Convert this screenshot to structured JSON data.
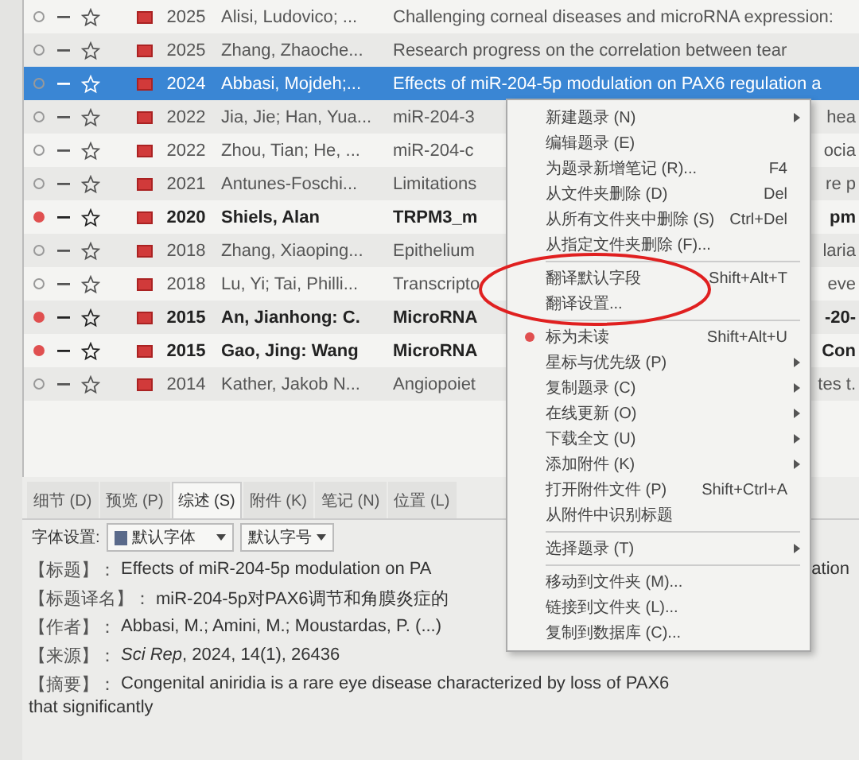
{
  "table": {
    "rows": [
      {
        "unread": false,
        "selected": false,
        "year": "2025",
        "author": "Alisi, Ludovico; ...",
        "title": "Challenging corneal diseases and microRNA expression:"
      },
      {
        "unread": false,
        "selected": false,
        "year": "2025",
        "author": "Zhang, Zhaoche...",
        "title": "Research progress on the correlation between tear"
      },
      {
        "unread": false,
        "selected": true,
        "year": "2024",
        "author": "Abbasi, Mojdeh;...",
        "title": "Effects of miR-204-5p modulation on PAX6 regulation a"
      },
      {
        "unread": false,
        "selected": false,
        "year": "2022",
        "author": "Jia, Jie; Han, Yua...",
        "title": "miR-204-3",
        "tail": "hea"
      },
      {
        "unread": false,
        "selected": false,
        "year": "2022",
        "author": "Zhou, Tian; He, ...",
        "title": "miR-204-c",
        "tail": "ocia"
      },
      {
        "unread": false,
        "selected": false,
        "year": "2021",
        "author": "Antunes-Foschi...",
        "title": "Limitations",
        "tail": "re p"
      },
      {
        "unread": true,
        "selected": false,
        "year": "2020",
        "author": "Shiels, Alan",
        "title": "TRPM3_m",
        "tail": "pm"
      },
      {
        "unread": false,
        "selected": false,
        "year": "2018",
        "author": "Zhang, Xiaoping...",
        "title": "Epithelium",
        "tail": "laria"
      },
      {
        "unread": false,
        "selected": false,
        "year": "2018",
        "author": "Lu, Yi; Tai, Philli...",
        "title": "Transcripto",
        "tail": "eve"
      },
      {
        "unread": true,
        "selected": false,
        "year": "2015",
        "author": "An, Jianhong: C.",
        "title": "MicroRNA",
        "tail": "-20-"
      },
      {
        "unread": true,
        "selected": false,
        "year": "2015",
        "author": "Gao, Jing: Wang",
        "title": "MicroRNA",
        "tail": "Con"
      },
      {
        "unread": false,
        "selected": false,
        "year": "2014",
        "author": "Kather, Jakob N...",
        "title": "Angiopoiet",
        "tail": "tes t."
      }
    ]
  },
  "detail": {
    "tabs": [
      {
        "label": "细节 (D)",
        "selected": false
      },
      {
        "label": "预览 (P)",
        "selected": false
      },
      {
        "label": "综述 (S)",
        "selected": true
      },
      {
        "label": "附件 (K)",
        "selected": false
      },
      {
        "label": "笔记 (N)",
        "selected": false
      },
      {
        "label": "位置 (L)",
        "selected": false
      }
    ],
    "font_label": "字体设置:",
    "font_family": "默认字体",
    "font_size": "默认字号",
    "lines": [
      {
        "label": "【标题】：",
        "value": "Effects of miR-204-5p modulation on PA",
        "tail": "ation"
      },
      {
        "label": "【标题译名】：",
        "value": "miR-204-5p对PAX6调节和角膜炎症的"
      },
      {
        "label": "【作者】：",
        "value": "Abbasi, M.; Amini, M.; Moustardas, P. (...)"
      },
      {
        "label": "【来源】：",
        "value": "*Sci Rep*, 2024, 14(1), 26436"
      },
      {
        "label": "【摘要】：",
        "value": "Congenital aniridia is a rare eye disease characterized by loss of PAX6"
      }
    ],
    "continuation": "that significantly"
  },
  "context_menu": {
    "items": [
      {
        "kind": "item",
        "label": "新建题录 (N)",
        "submenu": true
      },
      {
        "kind": "item",
        "label": "编辑题录 (E)"
      },
      {
        "kind": "item",
        "label": "为题录新增笔记 (R)...",
        "shortcut": "F4"
      },
      {
        "kind": "item",
        "label": "从文件夹删除 (D)",
        "shortcut": "Del"
      },
      {
        "kind": "item",
        "label": "从所有文件夹中删除 (S)",
        "shortcut": "Ctrl+Del"
      },
      {
        "kind": "item",
        "label": "从指定文件夹删除 (F)..."
      },
      {
        "kind": "separator"
      },
      {
        "kind": "item",
        "label": "翻译默认字段",
        "shortcut": "Shift+Alt+T"
      },
      {
        "kind": "item",
        "label": "翻译设置..."
      },
      {
        "kind": "separator"
      },
      {
        "kind": "dot",
        "label": "标为未读",
        "shortcut": "Shift+Alt+U"
      },
      {
        "kind": "item",
        "label": "星标与优先级 (P)",
        "submenu": true
      },
      {
        "kind": "item",
        "label": "复制题录 (C)",
        "submenu": true
      },
      {
        "kind": "item",
        "label": "在线更新 (O)",
        "submenu": true
      },
      {
        "kind": "item",
        "label": "下载全文 (U)",
        "submenu": true
      },
      {
        "kind": "item",
        "label": "添加附件 (K)",
        "submenu": true
      },
      {
        "kind": "item",
        "label": "打开附件文件 (P)",
        "shortcut": "Shift+Ctrl+A"
      },
      {
        "kind": "item",
        "label": "从附件中识别标题"
      },
      {
        "kind": "separator"
      },
      {
        "kind": "item",
        "label": "选择题录 (T)",
        "submenu": true
      },
      {
        "kind": "separator"
      },
      {
        "kind": "item",
        "label": "移动到文件夹 (M)..."
      },
      {
        "kind": "item",
        "label": "链接到文件夹 (L)..."
      },
      {
        "kind": "item",
        "label": "复制到数据库 (C)..."
      }
    ]
  }
}
